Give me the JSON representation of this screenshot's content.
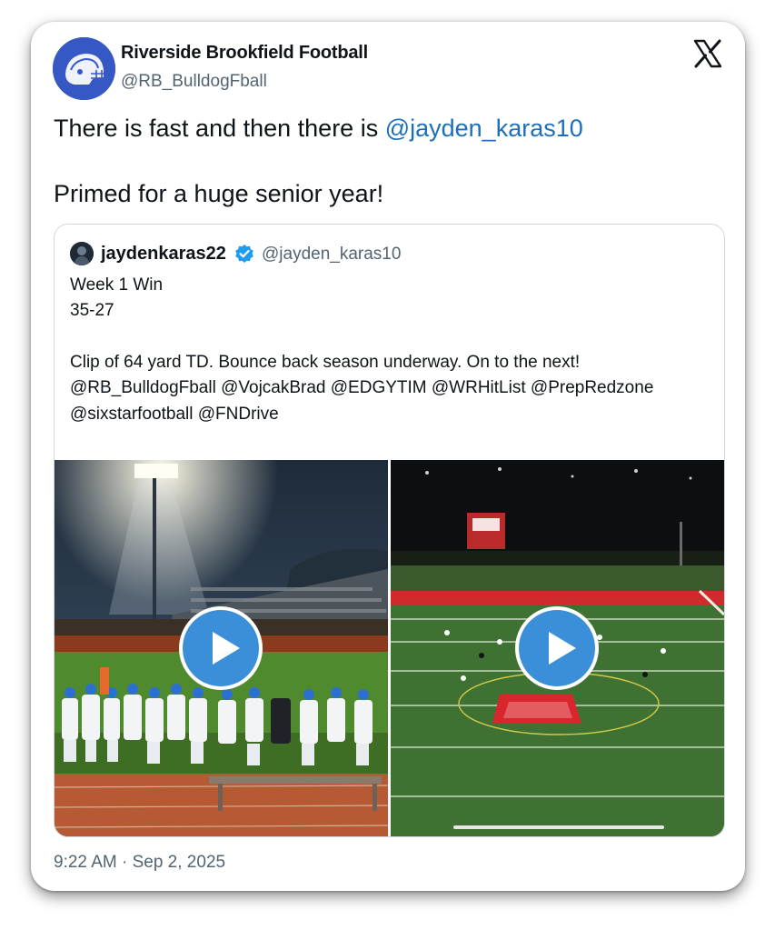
{
  "post": {
    "author_name": "Riverside Brookfield Football",
    "author_handle": "@RB_BulldogFball",
    "text_before_mention": "There is fast and then there is ",
    "mention": "@jayden_karas10",
    "text_line2": "Primed for a huge senior year!",
    "timestamp": "9:22 AM · Sep 2, 2025",
    "platform_logo": "x-logo-icon"
  },
  "quoted": {
    "author_name": "jaydenkaras22",
    "author_handle": "@jayden_karas10",
    "verified": true,
    "lines": [
      "Week 1 Win",
      "35-27",
      "Clip of 64 yard TD. Bounce back season underway. On to the next!",
      "@RB_BulldogFball @VojcakBrad @EDGYTIM @WRHitList @PrepRedzone",
      "@sixstarfootball @FNDrive"
    ],
    "media": [
      {
        "type": "video",
        "icon": "play-icon",
        "scene": "sideline-crowd-night"
      },
      {
        "type": "video",
        "icon": "play-icon",
        "scene": "aerial-field-wolves"
      }
    ]
  },
  "colors": {
    "link": "#1d6fb8",
    "avatar_bg": "#3558c4",
    "play_button": "#3b8fd9",
    "verified_badge": "#1d9bf0",
    "endzone_red": "#d8262c"
  }
}
